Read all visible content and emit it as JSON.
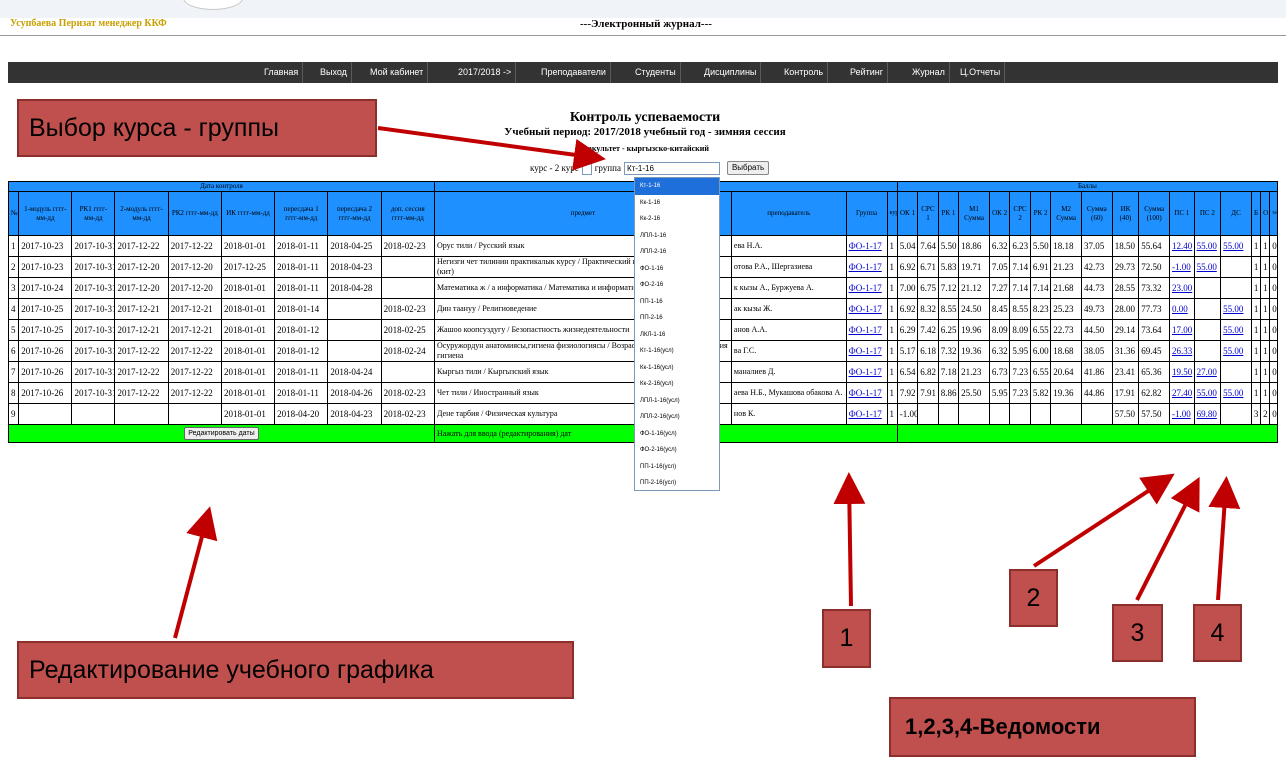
{
  "header": {
    "user": "Усупбаева Перизат менеджер ККФ",
    "site_title": "---Электронный журнал---"
  },
  "nav": [
    "Главная",
    "Выход",
    "Мой кабинет",
    "2017/2018 ->",
    "Преподаватели",
    "Студенты",
    "Дисциплины",
    "Контроль",
    "Рейтинг",
    "Журнал",
    "Ц.Отчеты"
  ],
  "page": {
    "title": "Контроль успеваемости",
    "period": "Учебный период: 2017/2018 учебный год - зимняя сессия",
    "faculty": "Факультет - кыргызско-китайский",
    "course_label": "курс - 2 курс",
    "group_label": "группа",
    "group_value": "Кт-1-16",
    "select_button": "Выбрать"
  },
  "group_options": [
    "Кт-1-16",
    "Кк-1-16",
    "Кк-2-16",
    "ЛПЛ-1-16",
    "ЛПЛ-2-16",
    "ФО-1-16",
    "ФО-2-16",
    "ПП-1-16",
    "ПП-2-16",
    "ЛКЛ-1-16",
    "Кт-1-16(усл)",
    "Кк-1-16(усл)",
    "Кк-2-16(усл)",
    "ЛПЛ-1-16(усл)",
    "ЛПЛ-2-16(усл)",
    "ФО-1-16(усл)",
    "ФО-2-16(усл)",
    "ПП-1-16(усл)",
    "ПП-2-16(усл)"
  ],
  "table": {
    "group_headers": {
      "dates": "Дата контроля",
      "scores": "Баллы"
    },
    "headers": {
      "num": "№",
      "date_cols": [
        "1-модуль гггг-мм-дд",
        "РК1 гггг-мм-дд",
        "2-модуль гггг-мм-дд",
        "РК2 гггг-мм-дд",
        "ИК гггг-мм-дд",
        "пересдача 1 гггг-мм-дд",
        "пересдача 2 гггг-мм-дд",
        "доп. сессия гггг-мм-дд"
      ],
      "subject": "предмет",
      "teacher": "преподаватель",
      "group": "Группа",
      "course": "курс",
      "score_cols": [
        "ОК 1",
        "СРС 1",
        "РК 1",
        "М1 Сумма",
        "ОК 2",
        "СРС 2",
        "РК 2",
        "М2 Сумма",
        "Сумма (60)",
        "ИК (40)",
        "Сумма (100)",
        "ПС 1",
        "ПС 2",
        "ДС",
        "Б",
        "О",
        "тек"
      ]
    },
    "rows": [
      {
        "n": "1",
        "dates": [
          "2017-10-23",
          "2017-10-31",
          "2017-12-22",
          "2017-12-22",
          "2018-01-01",
          "2018-01-11",
          "2018-04-25",
          "2018-02-23"
        ],
        "subject": "Орус тили / Русский язык",
        "teacher": "ева Н.А.",
        "group": "ФО-1-17",
        "course": "1",
        "scores": [
          "5.04",
          "7.64",
          "5.50",
          "18.86",
          "6.32",
          "6.23",
          "5.50",
          "18.18",
          "37.05",
          "18.50",
          "55.64",
          "12.40",
          "55.00",
          "55.00",
          "1",
          "1",
          "0"
        ]
      },
      {
        "n": "2",
        "dates": [
          "2017-10-23",
          "2017-10-31",
          "2017-12-20",
          "2017-12-20",
          "2017-12-25",
          "2018-01-11",
          "2018-04-23",
          ""
        ],
        "subject": "Негизги чет тилинин практикалык курсу / Практический курс изучаемого языка (кит)",
        "teacher": "отова Р.А., Шергазиева",
        "group": "ФО-1-17",
        "course": "1",
        "scores": [
          "6.92",
          "6.71",
          "5.83",
          "19.71",
          "7.05",
          "7.14",
          "6.91",
          "21.23",
          "42.73",
          "29.73",
          "72.50",
          "-1.00",
          "55.00",
          "",
          "1",
          "1",
          "0"
        ]
      },
      {
        "n": "3",
        "dates": [
          "2017-10-24",
          "2017-10-31",
          "2017-12-20",
          "2017-12-20",
          "2018-01-01",
          "2018-01-11",
          "2018-04-28",
          ""
        ],
        "subject": "Математика ж / а информатика / Математика и информатика",
        "teacher": "к кызы А., Буржуева А.",
        "group": "ФО-1-17",
        "course": "1",
        "scores": [
          "7.00",
          "6.75",
          "7.12",
          "21.12",
          "7.27",
          "7.14",
          "7.14",
          "21.68",
          "44.73",
          "28.55",
          "73.32",
          "23.00",
          "",
          "",
          "1",
          "1",
          "0"
        ]
      },
      {
        "n": "4",
        "dates": [
          "2017-10-25",
          "2017-10-31",
          "2017-12-21",
          "2017-12-21",
          "2018-01-01",
          "2018-01-14",
          "",
          "2018-02-23"
        ],
        "subject": "Дин таануу / Религиоведение",
        "teacher": "ак кызы Ж.",
        "group": "ФО-1-17",
        "course": "1",
        "scores": [
          "6.92",
          "8.32",
          "8.55",
          "24.50",
          "8.45",
          "8.55",
          "8.23",
          "25.23",
          "49.73",
          "28.00",
          "77.73",
          "0.00",
          "",
          "55.00",
          "1",
          "1",
          "0"
        ]
      },
      {
        "n": "5",
        "dates": [
          "2017-10-25",
          "2017-10-31",
          "2017-12-21",
          "2017-12-21",
          "2018-01-01",
          "2018-01-12",
          "",
          "2018-02-25"
        ],
        "subject": "Жашоо коопсуздугу / Безопастность жизнедеятельности",
        "teacher": "анов А.А.",
        "group": "ФО-1-17",
        "course": "1",
        "scores": [
          "6.29",
          "7.42",
          "6.25",
          "19.96",
          "8.09",
          "8.09",
          "6.55",
          "22.73",
          "44.50",
          "29.14",
          "73.64",
          "17.00",
          "",
          "55.00",
          "1",
          "1",
          "0"
        ]
      },
      {
        "n": "6",
        "dates": [
          "2017-10-26",
          "2017-10-31",
          "2017-12-22",
          "2017-12-22",
          "2018-01-01",
          "2018-01-12",
          "",
          "2018-02-24"
        ],
        "subject": "Осуружордун анатомиясы,гигиена физиологиясы / Возрастная анатомия, физиология гигиена",
        "teacher": "ва Г.С.",
        "group": "ФО-1-17",
        "course": "1",
        "scores": [
          "5.17",
          "6.18",
          "7.32",
          "19.36",
          "6.32",
          "5.95",
          "6.00",
          "18.68",
          "38.05",
          "31.36",
          "69.45",
          "26.33",
          "",
          "55.00",
          "1",
          "1",
          "0"
        ]
      },
      {
        "n": "7",
        "dates": [
          "2017-10-26",
          "2017-10-31",
          "2017-12-22",
          "2017-12-22",
          "2018-01-01",
          "2018-01-11",
          "2018-04-24",
          ""
        ],
        "subject": "Кыргыз тили / Кыргызский язык",
        "teacher": "маналиев Д.",
        "group": "ФО-1-17",
        "course": "1",
        "scores": [
          "6.54",
          "6.82",
          "7.18",
          "21.23",
          "6.73",
          "7.23",
          "6.55",
          "20.64",
          "41.86",
          "23.41",
          "65.36",
          "19.50",
          "27.00",
          "",
          "1",
          "1",
          "0"
        ]
      },
      {
        "n": "8",
        "dates": [
          "2017-10-26",
          "2017-10-31",
          "2017-12-22",
          "2017-12-22",
          "2018-01-01",
          "2018-01-11",
          "2018-04-26",
          "2018-02-23"
        ],
        "subject": "Чет тили / Иностранный язык",
        "teacher": "аева Н.Б., Мукашова обакова А.",
        "group": "ФО-1-17",
        "course": "1",
        "scores": [
          "7.92",
          "7.91",
          "8.86",
          "25.50",
          "5.95",
          "7.23",
          "5.82",
          "19.36",
          "44.86",
          "17.91",
          "62.82",
          "27.40",
          "55.00",
          "55.00",
          "1",
          "1",
          "0"
        ]
      },
      {
        "n": "9",
        "dates": [
          "",
          "",
          "",
          "",
          "2018-01-01",
          "2018-04-20",
          "2018-04-23",
          "2018-02-23"
        ],
        "subject": "Дене тарбия / Физическая культура",
        "teacher": "нов К.",
        "group": "ФО-1-17",
        "course": "1",
        "scores": [
          "-1.00",
          "",
          "",
          "",
          "",
          "",
          "",
          "",
          "",
          "57.50",
          "57.50",
          "-1.00",
          "69.80",
          "",
          "3",
          "2",
          "0"
        ]
      }
    ],
    "footer": {
      "edit_button": "Редактировать даты",
      "hint": "Нажать для ввода (редактирования) дат"
    }
  },
  "annotations": {
    "choose_group": "Выбор курса - группы",
    "edit_schedule": "Редактирование учебного графика",
    "n1": "1",
    "n2": "2",
    "n3": "3",
    "n4": "4",
    "statements": "1,2,3,4-Ведомости"
  },
  "colors": {
    "header_blue": "#1e90ff",
    "footer_green": "#00ff00",
    "callout_red": "#c0504d",
    "nav_dark": "#333333",
    "link_blue": "#0000cc"
  }
}
